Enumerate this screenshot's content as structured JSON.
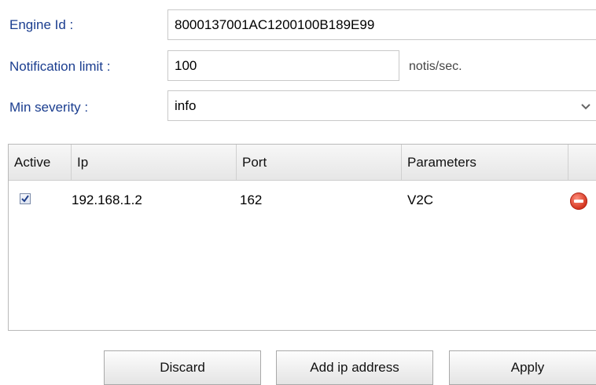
{
  "form": {
    "engine_id_label": "Engine Id :",
    "engine_id_value": "8000137001AC1200100B189E99",
    "notification_limit_label": "Notification limit :",
    "notification_limit_value": "100",
    "notification_limit_unit": "notis/sec.",
    "min_severity_label": "Min severity :",
    "min_severity_value": "info"
  },
  "table": {
    "headers": {
      "active": "Active",
      "ip": "Ip",
      "port": "Port",
      "parameters": "Parameters"
    },
    "rows": [
      {
        "active": true,
        "ip": "192.168.1.2",
        "port": "162",
        "parameters": "V2C"
      }
    ]
  },
  "buttons": {
    "discard": "Discard",
    "add_ip": "Add ip address",
    "apply": "Apply"
  },
  "icons": {
    "checkbox": "check-icon",
    "remove": "remove-icon",
    "dropdown": "chevron-down-icon"
  }
}
